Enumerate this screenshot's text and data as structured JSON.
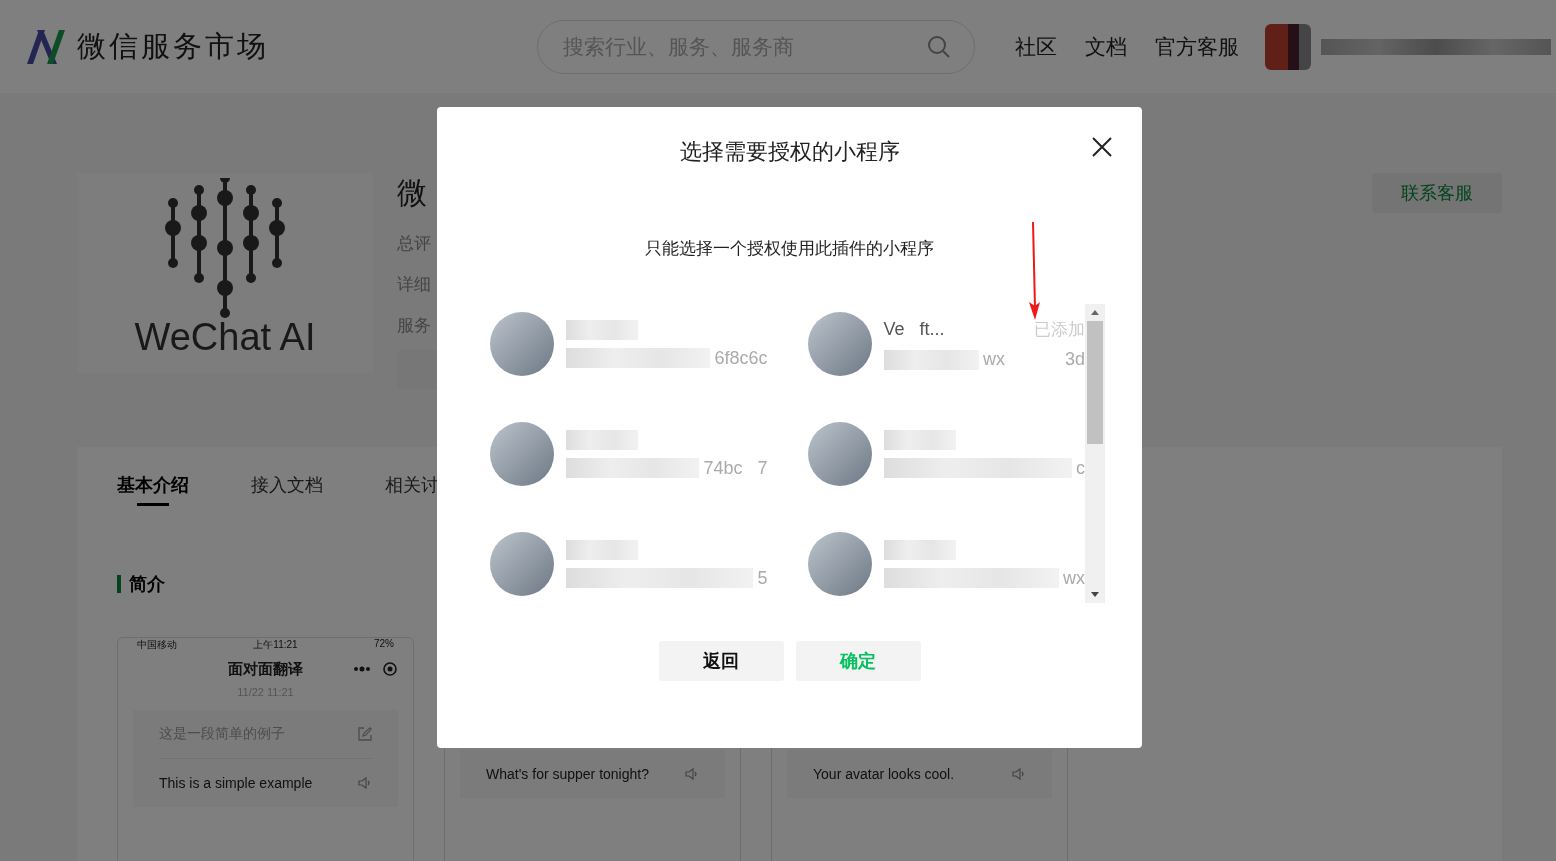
{
  "header": {
    "logo_text": "微信服务市场",
    "search": {
      "placeholder": "搜索行业、服务、服务商"
    },
    "nav": [
      "社区",
      "文档",
      "官方客服"
    ]
  },
  "product": {
    "logo_text": "WeChat AI",
    "title": "微",
    "info": [
      "总评",
      "详细",
      "服务"
    ],
    "contact_button": "联系客服"
  },
  "tabs": [
    {
      "label": "基本介绍",
      "selected": true
    },
    {
      "label": "接入文档",
      "selected": false
    },
    {
      "label": "相关讨",
      "selected": false
    }
  ],
  "section_title": "简介",
  "screenshots": [
    {
      "status_bar": {
        "carrier": "中国移动",
        "time": "上午11:21",
        "battery": "72%"
      },
      "title": "面对面翻译",
      "date": "11/22 11:21",
      "messages": [
        {
          "text": "这是一段简单的例子",
          "kind": "edit"
        },
        {
          "text": "This is a simple example",
          "kind": "speak"
        }
      ]
    },
    {
      "messages": [
        {
          "text": "What's for supper tonight?",
          "kind": "speak"
        }
      ]
    },
    {
      "messages": [
        {
          "text": "Your avatar looks cool.",
          "kind": "speak"
        }
      ]
    }
  ],
  "dialog": {
    "title": "选择需要授权的小程序",
    "subtitle": "只能选择一个授权使用此插件的小程序",
    "app_rows": [
      {
        "apps": [
          {
            "appid": "6f8c6c"
          },
          {
            "name": "Ve   ft...",
            "appid": "wx            3d",
            "status": "已添加"
          }
        ]
      },
      {
        "apps": [
          {
            "appid": "74bc   7"
          },
          {
            "appid": "c"
          }
        ]
      },
      {
        "apps": [
          {
            "appid": "5"
          },
          {
            "appid": "wx"
          }
        ]
      }
    ],
    "buttons": [
      {
        "label": "返回",
        "kind": "cancel"
      },
      {
        "label": "确定",
        "kind": "confirm"
      }
    ]
  }
}
